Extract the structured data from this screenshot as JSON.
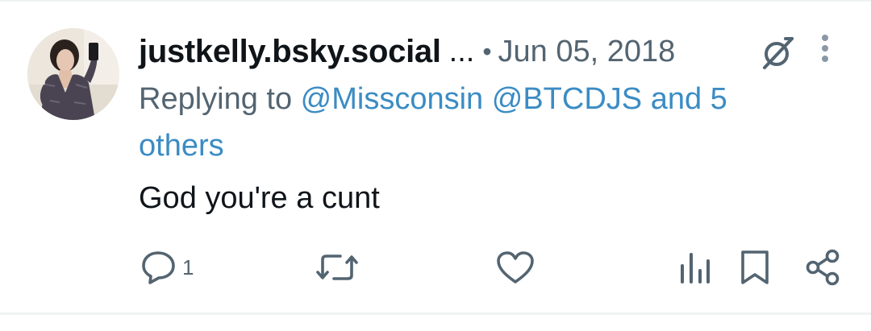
{
  "post": {
    "handle": "justkelly.bsky.social",
    "handle_truncation": "...",
    "separator": "•",
    "date": "Jun 05, 2018",
    "replying_prefix": "Replying to ",
    "mentions": [
      "@Missconsin",
      "@BTCDJS"
    ],
    "others_text": "and 5 others",
    "body": "God you're a cunt"
  },
  "actions": {
    "reply_count": "1"
  },
  "icons": {
    "avatar": "profile-photo",
    "grok": "grok-icon",
    "more": "more-vertical-icon",
    "reply": "reply-bubble-icon",
    "repost": "repost-icon",
    "like": "heart-icon",
    "views": "analytics-bars-icon",
    "bookmark": "bookmark-icon",
    "share": "share-icon"
  },
  "colors": {
    "text_primary": "#0f1419",
    "text_secondary": "#536471",
    "link": "#3b8cc4",
    "border": "#eff3f4",
    "background": "#ffffff"
  }
}
